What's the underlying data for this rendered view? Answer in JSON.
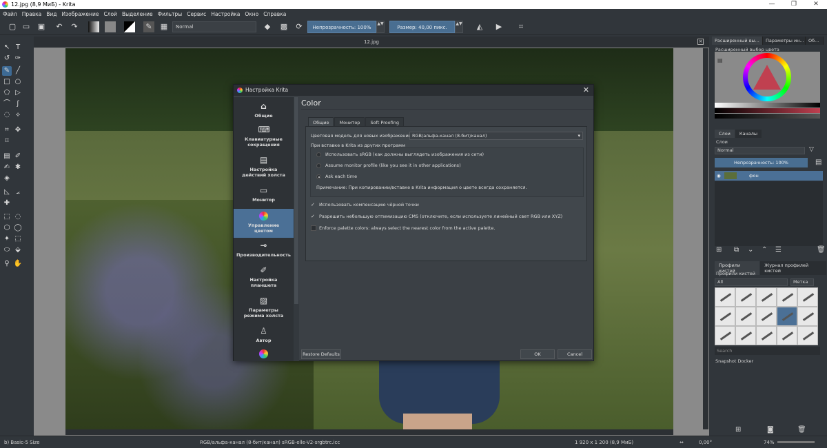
{
  "window": {
    "title": "12.jpg (8,9 МиБ)  - Krita",
    "controls": [
      "—",
      "❐",
      "✕"
    ]
  },
  "menu": [
    "Файл",
    "Правка",
    "Вид",
    "Изображение",
    "Слой",
    "Выделение",
    "Фильтры",
    "Сервис",
    "Настройка",
    "Окно",
    "Справка"
  ],
  "toolbar": {
    "blend_mode": "Normal",
    "opacity": "Непрозрачность: 100%",
    "size": "Размер: 40,00 пикс."
  },
  "canvas": {
    "tab_title": "12.jpg",
    "close": "×"
  },
  "status": {
    "brush": "b) Basic-5 Size",
    "color_space": "RGB/альфа-канал (8-бит/канал)  sRGB-elle-V2-srgbtrc.icc",
    "dimensions": "1 920 x 1 200 (8,9 МиБ)",
    "rotation": "0,00°",
    "zoom": "74%"
  },
  "dock": {
    "tabs": [
      "Расширенный вы...",
      "Параметры ин...",
      "Об..."
    ],
    "selector_title": "Расширенный выбор цвета",
    "layer_tabs": [
      "Слои",
      "Каналы"
    ],
    "layers_label": "Слои",
    "layers_blend": "Normal",
    "layers_opacity": "Непрозрачность: 100%",
    "layer_name": "фон",
    "brush_tabs": [
      "Профили кистей",
      "Журнал профилей кистей"
    ],
    "brush_label": "Профили кистей",
    "brush_filter": "All",
    "brush_tag": "Метка",
    "search_placeholder": "Search",
    "snapshot": "Snapshot Docker"
  },
  "dialog": {
    "title": "Настройка Krita",
    "close": "✕",
    "nav": [
      {
        "label_1": "Общие",
        "label_2": "",
        "icon": "home-icon"
      },
      {
        "label_1": "Клавиатурные",
        "label_2": "сокращения",
        "icon": "keyboard-icon"
      },
      {
        "label_1": "Настройка",
        "label_2": "действий холста",
        "icon": "canvas-actions-icon"
      },
      {
        "label_1": "Монитор",
        "label_2": "",
        "icon": "monitor-icon"
      },
      {
        "label_1": "Управление",
        "label_2": "цветом",
        "icon": "color-management-icon"
      },
      {
        "label_1": "Производительность",
        "label_2": "",
        "icon": "performance-icon"
      },
      {
        "label_1": "Настройка",
        "label_2": "планшета",
        "icon": "tablet-icon"
      },
      {
        "label_1": "Параметры",
        "label_2": "режима холста",
        "icon": "canvas-mode-icon"
      },
      {
        "label_1": "Автор",
        "label_2": "",
        "icon": "author-icon"
      }
    ],
    "heading": "Color",
    "tabs": [
      "Общие",
      "Монитор",
      "Soft Proofing"
    ],
    "color_model_label": "Цветовая модель для новых изображений:",
    "color_model_value": "RGB/альфа-канал (8-бит/канал)",
    "paste_label": "При вставке в Krita из других программ",
    "radio_1": "Использовать sRGB (как должны выглядеть изображения из сети)",
    "radio_2": "Assume monitor profile (like you see it in other applications)",
    "radio_3": "Ask each time",
    "note": "Примечание: При копировании/вставке в Krita информация о цвете всегда сохраняется.",
    "check_1": "Использовать компенсацию чёрной точки",
    "check_2": "Разрешить небольшую оптимизацию CMS (отключите, если используете линейный свет RGB или XYZ)",
    "check_3": "Enforce palette colors: always select the nearest color from the active palette.",
    "restore": "Restore Defaults",
    "ok": "OK",
    "cancel": "Cancel"
  }
}
